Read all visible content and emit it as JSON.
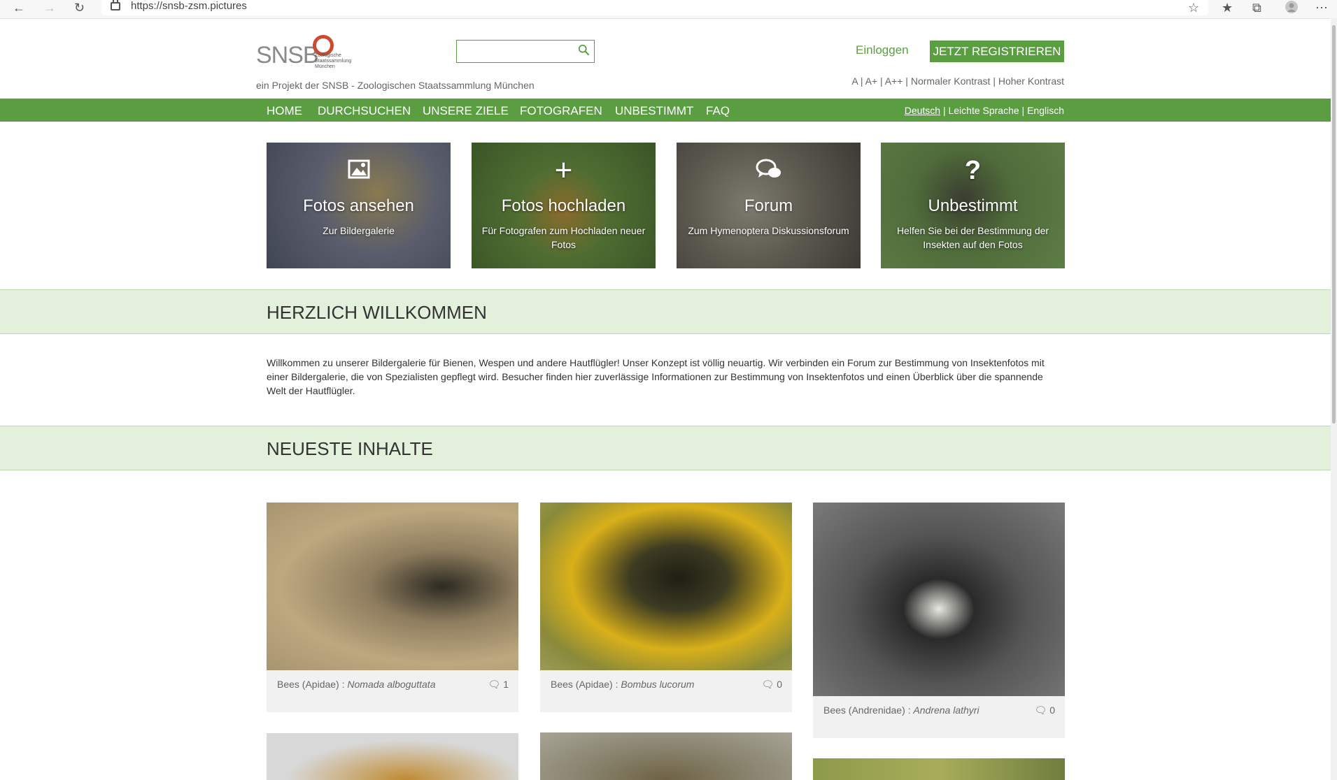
{
  "browser": {
    "url": "https://snsb-zsm.pictures"
  },
  "header": {
    "logo_text": "SNSB",
    "logo_sub": "Zoologische Staatssammlung München",
    "tagline": "ein Projekt der SNSB - Zoologischen Staatssammlung München",
    "login": "Einloggen",
    "register": "JETZT REGISTRIEREN",
    "a11y": "A | A+ | A++ | Normaler Kontrast | Hoher Kontrast"
  },
  "nav": {
    "items": [
      "HOME",
      "DURCHSUCHEN",
      "UNSERE ZIELE",
      "FOTOGRAFEN",
      "UNBESTIMMT",
      "FAQ"
    ],
    "lang_active": "Deutsch",
    "lang_rest": " | Leichte Sprache | Englisch"
  },
  "tiles": [
    {
      "title": "Fotos ansehen",
      "sub": "Zur Bildergalerie",
      "icon": "image-icon"
    },
    {
      "title": "Fotos hochladen",
      "sub": "Für Fotografen zum Hochladen neuer Fotos",
      "icon": "plus-icon"
    },
    {
      "title": "Forum",
      "sub": "Zum Hymenoptera Diskussionsforum",
      "icon": "chat-icon"
    },
    {
      "title": "Unbestimmt",
      "sub": "Helfen Sie bei der Bestimmung der Insekten auf den Fotos",
      "icon": "question-icon"
    }
  ],
  "welcome": {
    "heading": "HERZLICH WILLKOMMEN",
    "text": "Willkommen zu unserer Bildergalerie für Bienen, Wespen und andere Hautflügler! Unser Konzept ist völlig neuartig. Wir verbinden ein Forum zur Bestimmung von Insektenfotos mit einer Bildergalerie, die von Spezialisten gepflegt wird. Besucher finden hier zuverlässige Informationen zur Bestimmung von Insektenfotos und einen Überblick über die spannende Welt der Hautflügler."
  },
  "latest": {
    "heading": "NEUESTE INHALTE",
    "cards": [
      {
        "family": "Bees (Apidae) : ",
        "species": "Nomada alboguttata",
        "comments": "1"
      },
      {
        "family": "Bees (Apidae) : ",
        "species": "Bombus lucorum",
        "comments": "0"
      },
      {
        "family": "Bees (Andrenidae) : ",
        "species": "Andrena lathyri",
        "comments": "0"
      }
    ]
  },
  "colors": {
    "accent": "#5b9e42",
    "band": "#e2f0dc"
  }
}
